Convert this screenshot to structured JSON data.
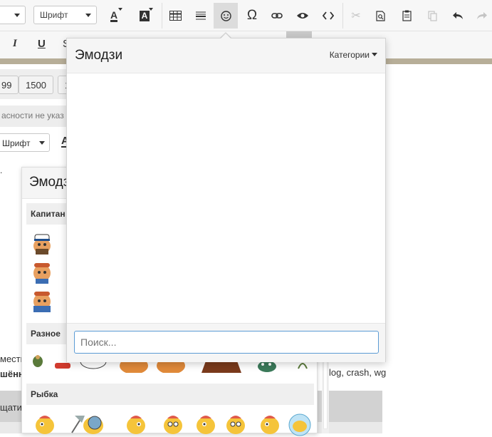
{
  "toolbar": {
    "paragraph_select_label": "",
    "font_select_label": "Шрифт",
    "text_color_icon": "text-color-icon",
    "bg_color_icon": "background-color-icon",
    "buttons": [
      {
        "name": "table-icon",
        "glyph": "▦"
      },
      {
        "name": "horizontal-rule-icon",
        "glyph": "☰"
      },
      {
        "name": "emoji-icon",
        "glyph": "☺"
      },
      {
        "name": "special-char-icon",
        "glyph": "Ω"
      },
      {
        "name": "link-icon",
        "glyph": "⛓"
      },
      {
        "name": "preview-icon",
        "glyph": "👁"
      },
      {
        "name": "source-code-icon",
        "glyph": "<>"
      },
      {
        "name": "cut-icon",
        "glyph": "✂"
      },
      {
        "name": "find-icon",
        "glyph": "🔍"
      },
      {
        "name": "paste-icon",
        "glyph": "📋"
      },
      {
        "name": "copy-icon",
        "glyph": "⧉"
      },
      {
        "name": "undo-icon",
        "glyph": "↶"
      },
      {
        "name": "redo-icon",
        "glyph": "↷"
      }
    ],
    "italic_label": "I",
    "underline_label": "U",
    "text_a_label": "A"
  },
  "background": {
    "tags": [
      "99",
      "1500",
      "1"
    ],
    "hint": "асности не указ",
    "font_select_label": "Шрифт",
    "left_text_1": "мести",
    "left_text_2": "шённ",
    "left_text_3": "щати",
    "right_text": "log, crash, wg"
  },
  "back_emoji_panel": {
    "title": "Эмодз",
    "categories": [
      "Капитан",
      "Разное",
      "Рыбка"
    ]
  },
  "emoji_popup": {
    "title": "Эмодзи",
    "categories_label": "Категории",
    "search_placeholder": "Поиск..."
  },
  "colors": {
    "accent_border": "#5b9bd5",
    "gold_strip": "#b7ae98",
    "active_button": "#dcdcdc"
  }
}
